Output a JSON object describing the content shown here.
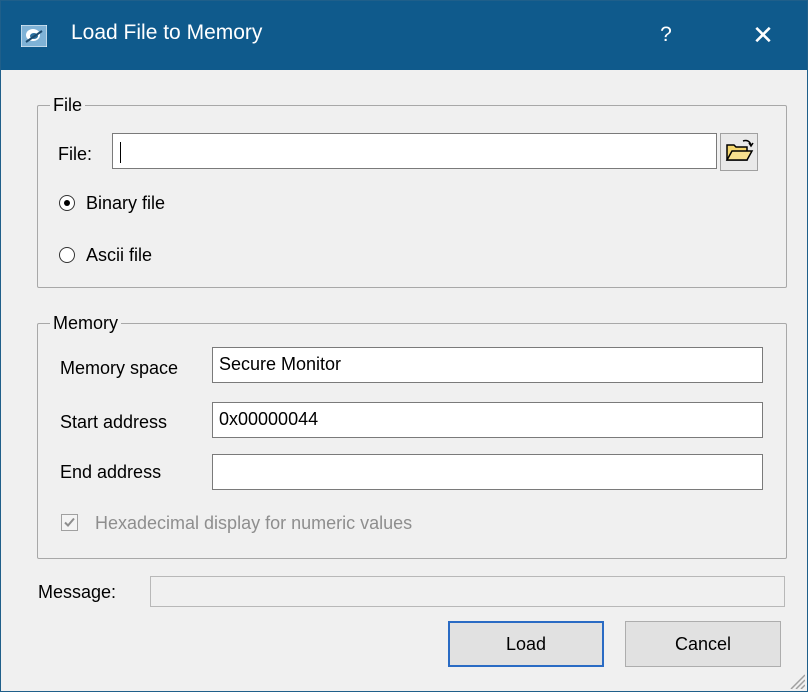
{
  "window": {
    "title": "Load File to Memory",
    "help_label": "?",
    "close_label": "✕"
  },
  "file_group": {
    "legend": "File",
    "file_label": "File:",
    "file_value": "",
    "browse_icon": "open-folder-icon",
    "binary_label": "Binary file",
    "ascii_label": "Ascii file",
    "selected_type": "Binary file"
  },
  "memory_group": {
    "legend": "Memory",
    "space_label": "Memory space",
    "space_value": "Secure Monitor",
    "start_label": "Start address",
    "start_value": "0x00000044",
    "end_label": "End address",
    "end_value": "",
    "hex_label": "Hexadecimal display for numeric values",
    "hex_checked": true
  },
  "message": {
    "label": "Message:",
    "value": ""
  },
  "buttons": {
    "load": "Load",
    "cancel": "Cancel"
  },
  "colors": {
    "titlebar": "#0f5a8c",
    "dialog_bg": "#f0f0f0",
    "default_button_border": "#2a6bc4"
  }
}
